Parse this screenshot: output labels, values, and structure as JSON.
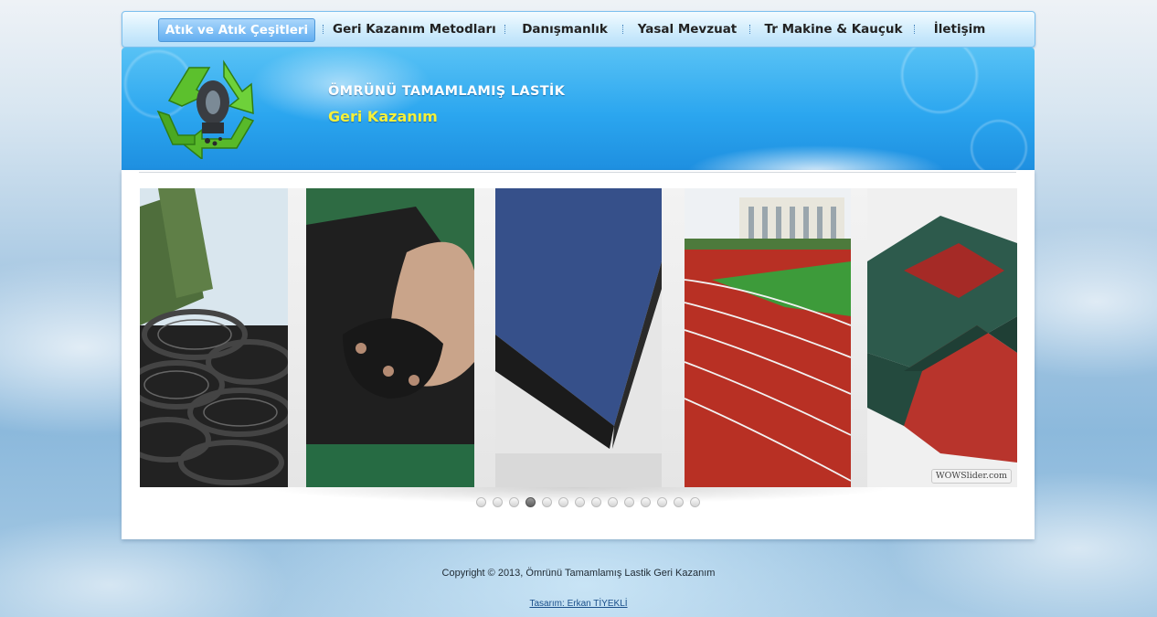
{
  "nav": {
    "items": [
      {
        "label": "Atık ve Atık Çeşitleri",
        "active": true
      },
      {
        "label": "Geri Kazanım Metodları",
        "active": false
      },
      {
        "label": "Danışmanlık",
        "active": false
      },
      {
        "label": "Yasal Mevzuat",
        "active": false
      },
      {
        "label": "Tr Makine & Kauçuk",
        "active": false
      },
      {
        "label": "İletişim",
        "active": false
      }
    ]
  },
  "header": {
    "title": "ÖMRÜNÜ TAMAMLAMIŞ LASTİK",
    "subtitle": "Geri Kazanım"
  },
  "slider": {
    "slides": [
      {
        "icon": "tire-pile-photo"
      },
      {
        "icon": "rubber-granules-photo"
      },
      {
        "icon": "rubber-mat-photo"
      },
      {
        "icon": "running-track-photo"
      },
      {
        "icon": "rubber-tiles-photo"
      }
    ],
    "badge": "WOWSlider.com",
    "page_count": 14,
    "active_page": 4
  },
  "footer": {
    "copyright": "Copyright © 2013, Ömrünü Tamamlamış Lastik Geri Kazanım",
    "designer": "Tasarım: Erkan TİYEKLİ"
  },
  "colors": {
    "nav_active": "#62aef1",
    "header_blue": "#2ba6ef",
    "subtitle_yellow": "#f5f03a"
  }
}
